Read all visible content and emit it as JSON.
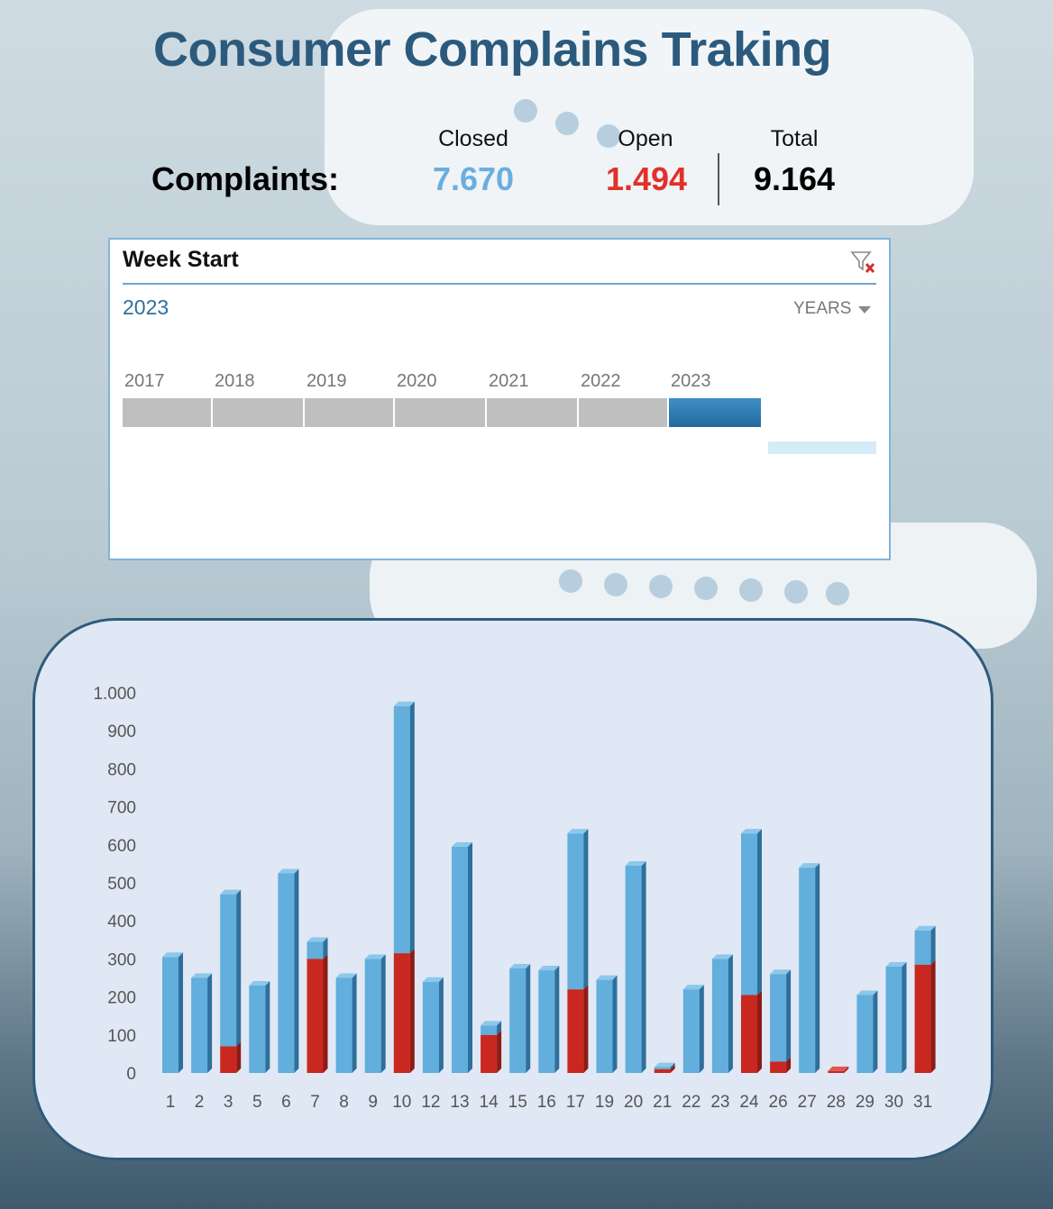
{
  "title": "Consumer Complains Traking",
  "kpi": {
    "label": "Complaints:",
    "closed_label": "Closed",
    "closed_value": "7.670",
    "open_label": "Open",
    "open_value": "1.494",
    "total_label": "Total",
    "total_value": "9.164"
  },
  "slicer": {
    "title": "Week Start",
    "selection": "2023",
    "level": "YEARS",
    "years": [
      "2017",
      "2018",
      "2019",
      "2020",
      "2021",
      "2022",
      "2023"
    ],
    "selected_year": "2023",
    "clear_filter_icon": "clear-filter-icon"
  },
  "colors": {
    "title": "#2b5a7d",
    "closed": "#6aaee0",
    "open": "#e0312b",
    "bar_closed": "#62aedd",
    "bar_open": "#c8281f"
  },
  "chart_data": {
    "type": "bar",
    "stacked": true,
    "categories": [
      "1",
      "2",
      "3",
      "5",
      "6",
      "7",
      "8",
      "9",
      "10",
      "12",
      "13",
      "14",
      "15",
      "16",
      "17",
      "19",
      "20",
      "21",
      "22",
      "23",
      "24",
      "26",
      "27",
      "28",
      "29",
      "30",
      "31"
    ],
    "series": [
      {
        "key": "open",
        "values": [
          0,
          0,
          70,
          0,
          0,
          300,
          0,
          0,
          315,
          0,
          0,
          100,
          0,
          0,
          220,
          0,
          0,
          10,
          0,
          0,
          205,
          30,
          0,
          5,
          0,
          0,
          285
        ]
      },
      {
        "key": "closed",
        "values": [
          305,
          250,
          400,
          230,
          525,
          45,
          250,
          300,
          650,
          240,
          595,
          25,
          275,
          270,
          410,
          245,
          545,
          5,
          220,
          300,
          425,
          230,
          540,
          0,
          205,
          280,
          90
        ]
      }
    ],
    "ylim": [
      0,
      1000
    ],
    "yticks": [
      0,
      100,
      200,
      300,
      400,
      500,
      600,
      700,
      800,
      900,
      1000
    ],
    "ytick_labels": [
      "0",
      "100",
      "200",
      "300",
      "400",
      "500",
      "600",
      "700",
      "800",
      "900",
      "1.000"
    ],
    "grid": false,
    "legend": "none"
  }
}
